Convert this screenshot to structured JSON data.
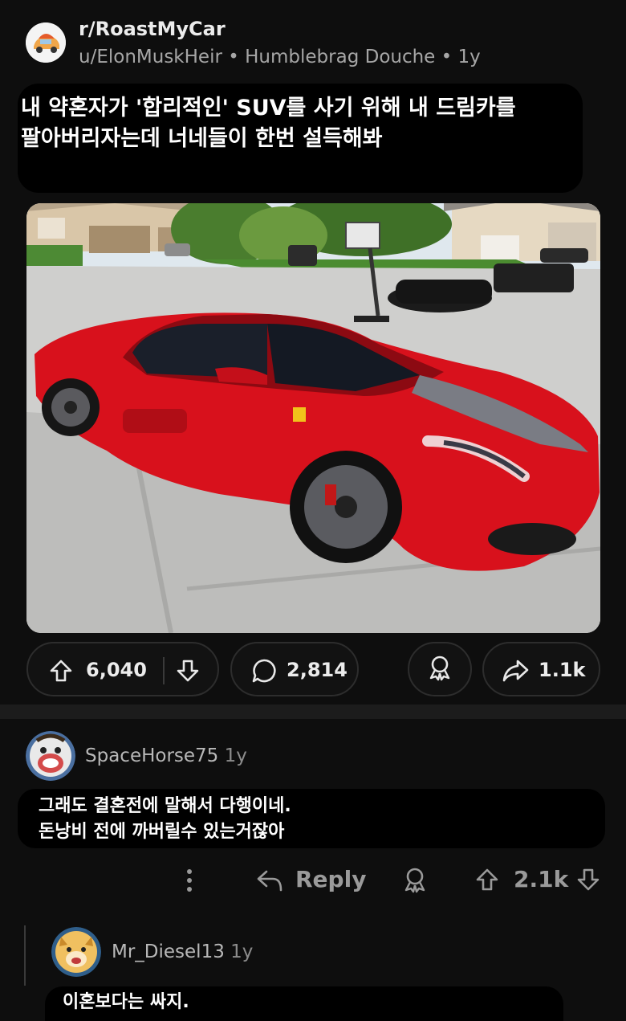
{
  "post": {
    "subreddit": "r/RoastMyCar",
    "author": "u/ElonMuskHeir",
    "flair": "Humblebrag Douche",
    "age": "1y",
    "title": "내 약혼자가 '합리적인' SUV를 사기 위해 내 드림카를 팔아버리자는데 너네들이 한번 설득해봐",
    "upvotes": "6,040",
    "comments": "2,814",
    "shares": "1.1k"
  },
  "comments": [
    {
      "username": "SpaceHorse75",
      "age": "1y",
      "body_line1": "그래도 결혼전에 말해서 다행이네.",
      "body_line2": "돈낭비 전에 까버릴수 있는거잖아",
      "reply_label": "Reply",
      "score": "2.1k"
    },
    {
      "username": "Mr_Diesel13",
      "age": "1y",
      "body": "이혼보다는 싸지."
    }
  ],
  "colors": {
    "background": "#0e0e0e",
    "text_box": "#000000",
    "car_red": "#d8111c",
    "muted_text": "#a6a6a6"
  },
  "icons": [
    "subreddit-avatar",
    "upvote-icon",
    "downvote-icon",
    "comment-icon",
    "award-icon",
    "share-icon",
    "more-icon",
    "reply-icon"
  ]
}
